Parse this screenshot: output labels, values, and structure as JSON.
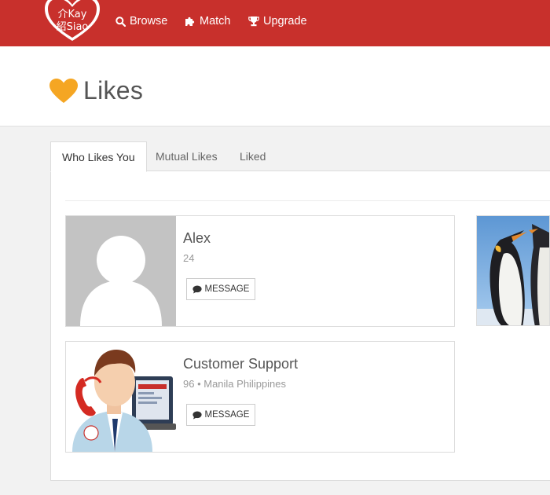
{
  "brand": {
    "logo_line1": "介Kay",
    "logo_line2": "紹Siao"
  },
  "nav": {
    "browse": "Browse",
    "match": "Match",
    "upgrade": "Upgrade"
  },
  "page": {
    "title": "Likes"
  },
  "tabs": [
    "Who Likes You",
    "Mutual Likes",
    "Liked"
  ],
  "cards": [
    {
      "name": "Alex",
      "info": "24",
      "button": "MESSAGE"
    },
    {
      "name": "Customer Support",
      "info": "96 • Manila Philippines",
      "button": "MESSAGE"
    }
  ],
  "colors": {
    "brand": "#c8302c",
    "heart": "#f5a623"
  }
}
